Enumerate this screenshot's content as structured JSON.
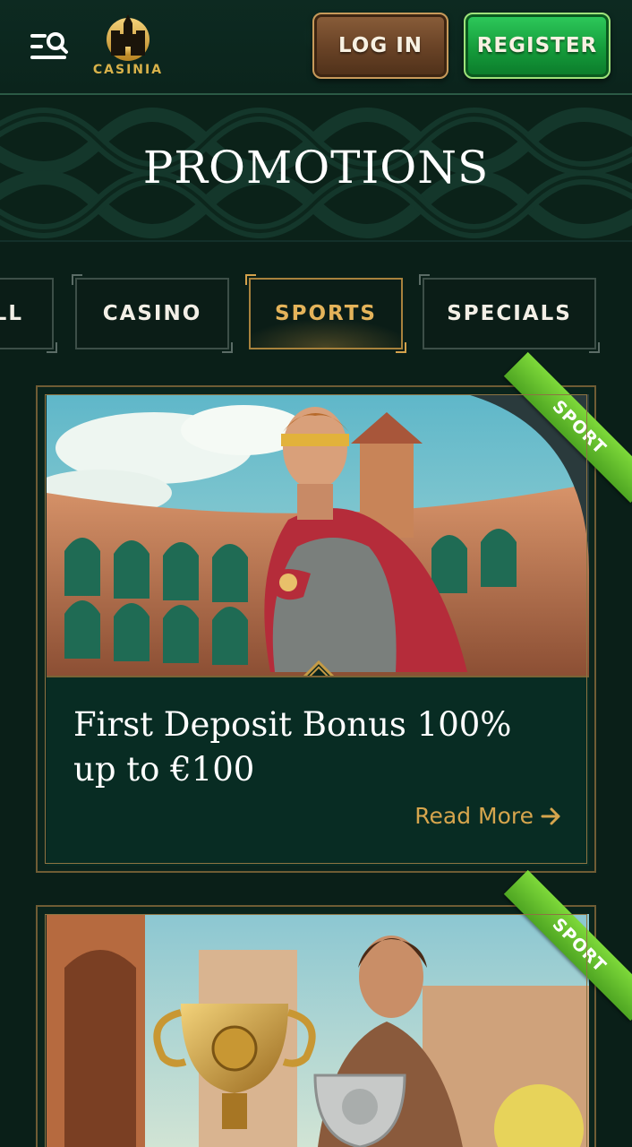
{
  "header": {
    "logo_text": "CASINIA",
    "login_label": "LOG IN",
    "register_label": "REGISTER"
  },
  "banner": {
    "title": "PROMOTIONS"
  },
  "tabs": [
    {
      "label": "ALL",
      "active": false
    },
    {
      "label": "CASINO",
      "active": false
    },
    {
      "label": "SPORTS",
      "active": true
    },
    {
      "label": "SPECIALS",
      "active": false
    }
  ],
  "promotions": [
    {
      "badge": "SPORT",
      "title": "First Deposit Bonus 100% up to €100",
      "read_more": "Read More"
    },
    {
      "badge": "SPORT",
      "title": "",
      "read_more": ""
    }
  ],
  "colors": {
    "background": "#0a1f18",
    "gold": "#d6a54d",
    "register_green": "#159c3b",
    "login_brown": "#6b4427",
    "badge_green": "#6cc52f"
  },
  "icons": [
    "menu-search-icon",
    "castle-logo-icon",
    "arrow-right-icon",
    "diamond-ornament-icon"
  ]
}
